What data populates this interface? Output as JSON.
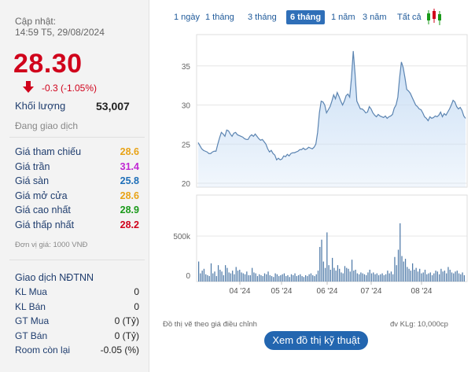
{
  "quote": {
    "update_label": "Cập nhật:",
    "update_time": "14:59 T5, 29/08/2024",
    "price": "28.30",
    "change": "-0.3 (-1.05%)",
    "volume_label": "Khối lượng",
    "volume_value": "53,007",
    "status": "Đang giao dịch",
    "unit": "Đơn vị giá: 1000 VNĐ"
  },
  "prices": [
    {
      "label": "Giá tham chiếu",
      "value": "28.6",
      "color": "#e8a317"
    },
    {
      "label": "Giá trần",
      "value": "31.4",
      "color": "#c026d3"
    },
    {
      "label": "Giá sàn",
      "value": "25.8",
      "color": "#1e6fb8"
    },
    {
      "label": "Giá mở cửa",
      "value": "28.6",
      "color": "#e8a317"
    },
    {
      "label": "Giá cao nhất",
      "value": "28.9",
      "color": "#1a9a1a"
    },
    {
      "label": "Giá thấp nhất",
      "value": "28.2",
      "color": "#d0021b"
    }
  ],
  "foreign": {
    "title": "Giao dịch NĐTNN",
    "rows": [
      {
        "label": "KL Mua",
        "value": "0"
      },
      {
        "label": "KL Bán",
        "value": "0"
      },
      {
        "label": "GT Mua",
        "value": "0 (Tỷ)"
      },
      {
        "label": "GT Bán",
        "value": "0 (Tỷ)"
      },
      {
        "label": "Room còn lại",
        "value": "-0.05 (%)"
      }
    ]
  },
  "tabs": [
    {
      "label": "1 ngày",
      "active": false
    },
    {
      "label": "1 tháng",
      "active": false
    },
    {
      "label": "3 tháng",
      "active": false
    },
    {
      "label": "6 tháng",
      "active": true
    },
    {
      "label": "1 năm",
      "active": false
    },
    {
      "label": "3 năm",
      "active": false
    },
    {
      "label": "Tất cả",
      "active": false
    }
  ],
  "chart_note": "Đồ thị vẽ theo giá điều chỉnh",
  "volume_note": "đv KLg: 10,000cp",
  "tech_button": "Xem đồ thị kỹ thuật",
  "chart_data": {
    "type": "area",
    "price_series": {
      "y_ticks": [
        "35",
        "30",
        "25",
        "20"
      ],
      "y_values": [
        35,
        30,
        25,
        20
      ],
      "ylim": [
        19.5,
        39
      ],
      "values": [
        25.2,
        24.8,
        24.4,
        24.2,
        24.1,
        24.0,
        23.8,
        23.8,
        24.0,
        24.1,
        24.1,
        25.0,
        25.8,
        26.5,
        26.3,
        26.0,
        26.8,
        26.7,
        26.3,
        26.0,
        26.4,
        26.5,
        26.2,
        26.1,
        26.0,
        25.9,
        25.7,
        25.6,
        25.6,
        26.0,
        26.2,
        26.0,
        26.3,
        26.0,
        25.7,
        25.5,
        25.6,
        25.3,
        25.0,
        24.4,
        24.0,
        24.2,
        23.8,
        23.6,
        23.0,
        23.2,
        23.0,
        23.1,
        23.5,
        23.4,
        23.7,
        23.5,
        23.8,
        23.9,
        23.9,
        24.0,
        24.1,
        24.3,
        24.3,
        24.5,
        24.3,
        24.4,
        24.6,
        24.5,
        24.4,
        24.6,
        25.0,
        26.5,
        29.0,
        30.5,
        30.4,
        30.0,
        29.0,
        29.4,
        29.8,
        30.5,
        31.3,
        30.8,
        31.6,
        31.1,
        30.5,
        30.0,
        30.5,
        31.2,
        31.4,
        31.0,
        33.5,
        36.9,
        34.0,
        30.5,
        30.0,
        29.5,
        29.5,
        29.3,
        29.0,
        29.1,
        29.8,
        29.5,
        29.0,
        28.7,
        28.5,
        28.8,
        28.6,
        28.5,
        28.4,
        28.6,
        28.3,
        28.5,
        28.6,
        28.8,
        29.6,
        30.0,
        31.0,
        33.5,
        35.5,
        34.8,
        33.5,
        32.0,
        31.8,
        31.5,
        31.0,
        30.5,
        30.0,
        29.8,
        29.5,
        29.4,
        29.0,
        28.5,
        28.3,
        28.0,
        28.5,
        28.3,
        28.4,
        28.6,
        28.5,
        28.7,
        29.1,
        28.5,
        28.9,
        28.7,
        29.1,
        29.5,
        30.0,
        30.6,
        30.4,
        29.8,
        29.5,
        29.7,
        29.3,
        28.6,
        28.3
      ]
    },
    "volume_series": {
      "y_ticks": [
        "500k",
        "0"
      ],
      "y_values": [
        500000,
        0
      ],
      "ylim": [
        0,
        950000
      ],
      "values": [
        220000,
        90000,
        120000,
        140000,
        80000,
        70000,
        60000,
        200000,
        90000,
        110000,
        60000,
        180000,
        130000,
        110000,
        70000,
        180000,
        150000,
        100000,
        90000,
        120000,
        80000,
        160000,
        120000,
        130000,
        100000,
        90000,
        80000,
        110000,
        70000,
        70000,
        150000,
        100000,
        90000,
        60000,
        80000,
        70000,
        60000,
        90000,
        80000,
        110000,
        70000,
        60000,
        50000,
        90000,
        80000,
        60000,
        70000,
        80000,
        90000,
        60000,
        70000,
        50000,
        80000,
        70000,
        90000,
        60000,
        70000,
        80000,
        60000,
        50000,
        70000,
        60000,
        80000,
        90000,
        70000,
        60000,
        80000,
        120000,
        380000,
        460000,
        220000,
        150000,
        540000,
        180000,
        130000,
        260000,
        150000,
        120000,
        180000,
        140000,
        100000,
        90000,
        170000,
        150000,
        140000,
        110000,
        240000,
        120000,
        130000,
        90000,
        80000,
        100000,
        90000,
        80000,
        70000,
        100000,
        130000,
        90000,
        100000,
        80000,
        90000,
        70000,
        80000,
        90000,
        70000,
        80000,
        120000,
        90000,
        110000,
        80000,
        270000,
        180000,
        350000,
        640000,
        280000,
        220000,
        250000,
        160000,
        140000,
        120000,
        200000,
        130000,
        150000,
        110000,
        140000,
        90000,
        100000,
        130000,
        80000,
        90000,
        100000,
        70000,
        90000,
        120000,
        110000,
        80000,
        140000,
        110000,
        120000,
        90000,
        160000,
        130000,
        100000,
        90000,
        110000,
        120000,
        90000,
        80000,
        100000,
        70000
      ]
    },
    "x_ticks": [
      "04 '24",
      "05 '24",
      "06 '24",
      "07 '24",
      "08 '24"
    ],
    "area_color": "#c9def5",
    "line_color": "#5b84b1",
    "bar_color": "#4f7aa8"
  }
}
